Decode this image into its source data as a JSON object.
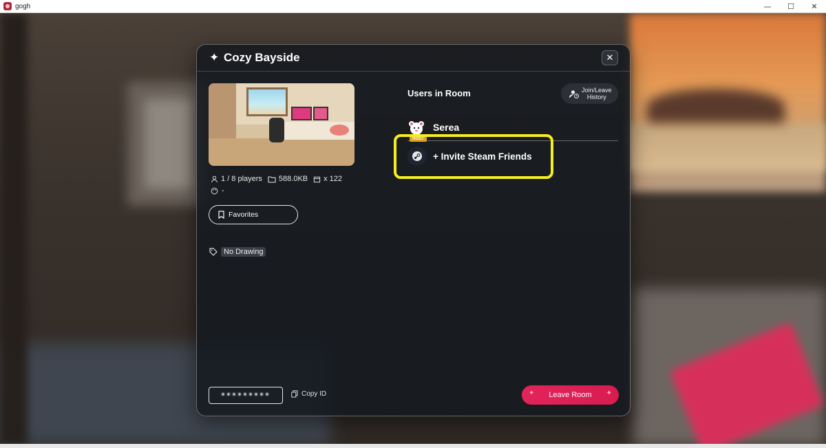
{
  "window": {
    "title": "gogh",
    "minimize": "—",
    "maximize": "☐",
    "close": "✕"
  },
  "modal": {
    "title": "Cozy Bayside",
    "sparkle_icon": "✦",
    "close_icon": "✕",
    "players": "1 / 8 players",
    "size": "588.0KB",
    "count": "x 122",
    "palette_value": "-",
    "favorites_label": "Favorites",
    "tag": "No Drawing",
    "room_id_masked": "*********",
    "copy_id_label": "Copy ID",
    "leave_label": "Leave Room",
    "leave_spark": "✦"
  },
  "users_panel": {
    "title": "Users in Room",
    "history_label_line1": "Join/Leave",
    "history_label_line2": "History",
    "users": [
      {
        "name": "Serea",
        "badge": "HOST"
      }
    ],
    "invite_label": "+ Invite Steam Friends"
  },
  "colors": {
    "accent": "#e2245a",
    "highlight": "#f6ee1e",
    "host_badge": "#e0a21a"
  }
}
